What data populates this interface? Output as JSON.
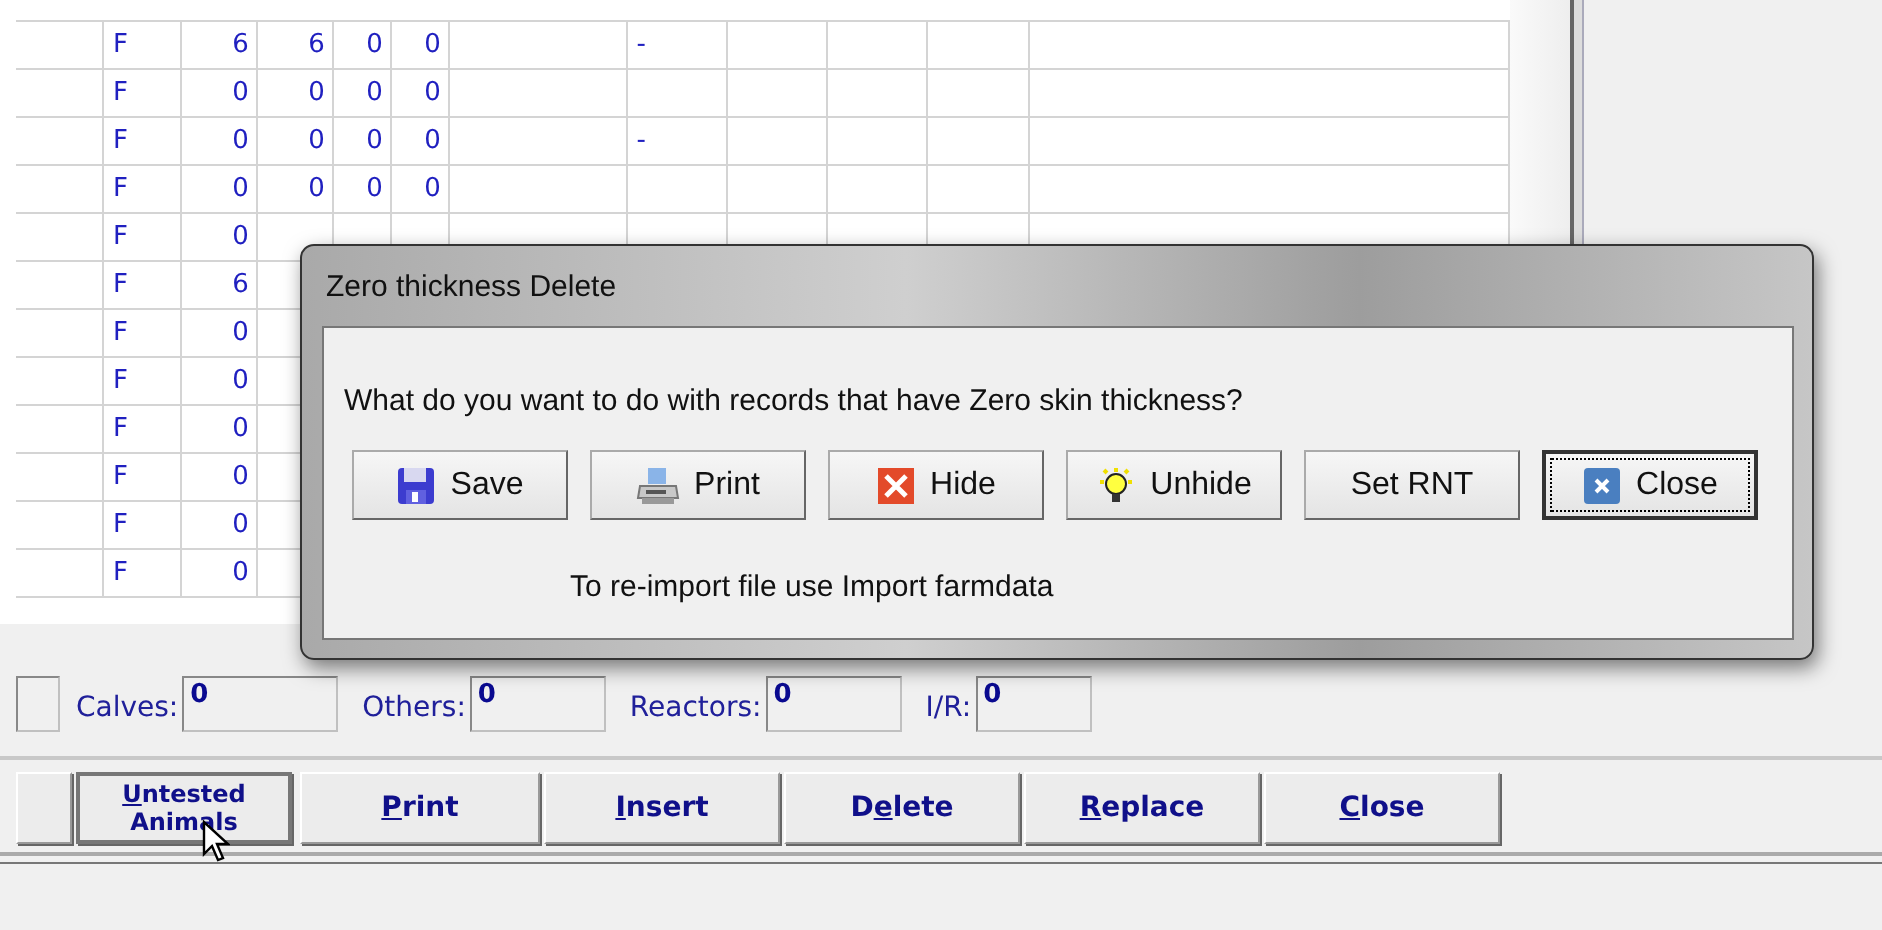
{
  "grid": {
    "rows": [
      {
        "sex": "F",
        "n1": "6",
        "n2": "6",
        "n3": "0",
        "n4": "0",
        "c6": "-"
      },
      {
        "sex": "F",
        "n1": "0",
        "n2": "0",
        "n3": "0",
        "n4": "0"
      },
      {
        "sex": "F",
        "n1": "0",
        "n2": "0",
        "n3": "0",
        "n4": "0",
        "c6": "-"
      },
      {
        "sex": "F",
        "n1": "0",
        "n2": "0",
        "n3": "0",
        "n4": "0"
      },
      {
        "sex": "F",
        "n1": "0"
      },
      {
        "sex": "F",
        "n1": "6"
      },
      {
        "sex": "F",
        "n1": "0"
      },
      {
        "sex": "F",
        "n1": "0"
      },
      {
        "sex": "F",
        "n1": "0"
      },
      {
        "sex": "F",
        "n1": "0"
      },
      {
        "sex": "F",
        "n1": "0"
      },
      {
        "sex": "F",
        "n1": "0"
      }
    ]
  },
  "counts": [
    {
      "label": "Calves:",
      "value": "0"
    },
    {
      "label": "Others:",
      "value": "0"
    },
    {
      "label": "Reactors:",
      "value": "0"
    },
    {
      "label": "I/R:",
      "value": "0"
    }
  ],
  "buttons": [
    {
      "key": "U",
      "rest": "ntested Animals"
    },
    {
      "key": "P",
      "rest": "rint"
    },
    {
      "key": "I",
      "rest": "nsert"
    },
    {
      "pre": "D",
      "key": "e",
      "rest": "lete"
    },
    {
      "key": "R",
      "rest": "eplace"
    },
    {
      "key": "C",
      "rest": "lose"
    }
  ],
  "dialog": {
    "title": "Zero thickness Delete",
    "question": "What do you want to do with records that have Zero skin thickness?",
    "buttons": [
      {
        "kind": "save",
        "label": "Save",
        "focused": false
      },
      {
        "kind": "print",
        "label": "Print",
        "focused": false
      },
      {
        "kind": "hide",
        "label": "Hide",
        "focused": false
      },
      {
        "kind": "unhide",
        "label": "Unhide",
        "focused": false
      },
      {
        "kind": "plain",
        "label": "Set RNT",
        "focused": false
      },
      {
        "kind": "close",
        "label": "Close",
        "focused": true
      }
    ],
    "note": "To re-import file use Import farmdata"
  }
}
